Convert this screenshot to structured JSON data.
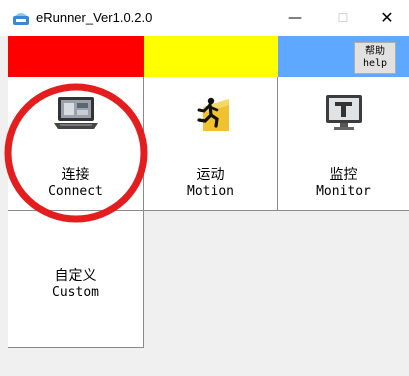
{
  "window": {
    "title": "eRunner_Ver1.0.2.0",
    "minimize": "—",
    "maximize": "☐",
    "close": "✕"
  },
  "colors": {
    "strip_red": "#ff0000",
    "strip_yellow": "#ffff00",
    "strip_blue": "#5fa8ff",
    "annotation": "#e41e1e"
  },
  "help": {
    "label_cn": "帮助",
    "label_en": "help"
  },
  "tiles": [
    {
      "label_cn": "连接",
      "label_en": "Connect",
      "icon": "laptop-icon"
    },
    {
      "label_cn": "运动",
      "label_en": "Motion",
      "icon": "running-man-icon"
    },
    {
      "label_cn": "监控",
      "label_en": "Monitor",
      "icon": "monitor-icon"
    },
    {
      "label_cn": "自定义",
      "label_en": "Custom",
      "icon": ""
    }
  ]
}
